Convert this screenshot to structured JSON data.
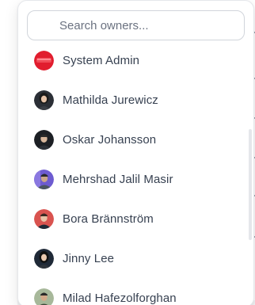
{
  "search": {
    "placeholder": "Search owners..."
  },
  "owners": [
    {
      "name": "System Admin",
      "avatar_icon": "system-logo-icon",
      "avatar_color": "#e11d2e"
    },
    {
      "name": "Mathilda Jurewicz",
      "avatar_icon": "user-photo-icon",
      "avatar_color": "#1f2937"
    },
    {
      "name": "Oskar Johansson",
      "avatar_icon": "user-photo-icon",
      "avatar_color": "#111827"
    },
    {
      "name": "Mehrshad Jalil Masir",
      "avatar_icon": "user-photo-icon",
      "avatar_color": "#6d5bd0"
    },
    {
      "name": "Bora Brännström",
      "avatar_icon": "user-photo-icon",
      "avatar_color": "#d9534f"
    },
    {
      "name": "Jinny Lee",
      "avatar_icon": "user-photo-icon",
      "avatar_color": "#1f2937"
    },
    {
      "name": "Milad Hafezolforghan",
      "avatar_icon": "user-photo-icon",
      "avatar_color": "#a7b89a"
    }
  ]
}
